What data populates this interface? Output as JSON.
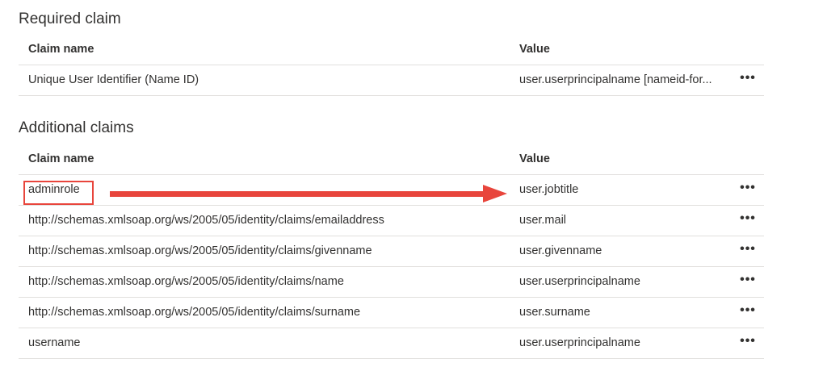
{
  "required_section": {
    "title": "Required claim",
    "columns": {
      "name": "Claim name",
      "value": "Value"
    },
    "rows": [
      {
        "name": "Unique User Identifier (Name ID)",
        "value": "user.userprincipalname [nameid-for...",
        "more": "•••"
      }
    ]
  },
  "additional_section": {
    "title": "Additional claims",
    "columns": {
      "name": "Claim name",
      "value": "Value"
    },
    "rows": [
      {
        "name": "adminrole",
        "value": "user.jobtitle",
        "more": "•••"
      },
      {
        "name": "http://schemas.xmlsoap.org/ws/2005/05/identity/claims/emailaddress",
        "value": "user.mail",
        "more": "•••"
      },
      {
        "name": "http://schemas.xmlsoap.org/ws/2005/05/identity/claims/givenname",
        "value": "user.givenname",
        "more": "•••"
      },
      {
        "name": "http://schemas.xmlsoap.org/ws/2005/05/identity/claims/name",
        "value": "user.userprincipalname",
        "more": "•••"
      },
      {
        "name": "http://schemas.xmlsoap.org/ws/2005/05/identity/claims/surname",
        "value": "user.surname",
        "more": "•••"
      },
      {
        "name": "username",
        "value": "user.userprincipalname",
        "more": "•••"
      }
    ]
  },
  "annotation": {
    "color": "#e8453c",
    "highlighted_claim": "adminrole"
  }
}
